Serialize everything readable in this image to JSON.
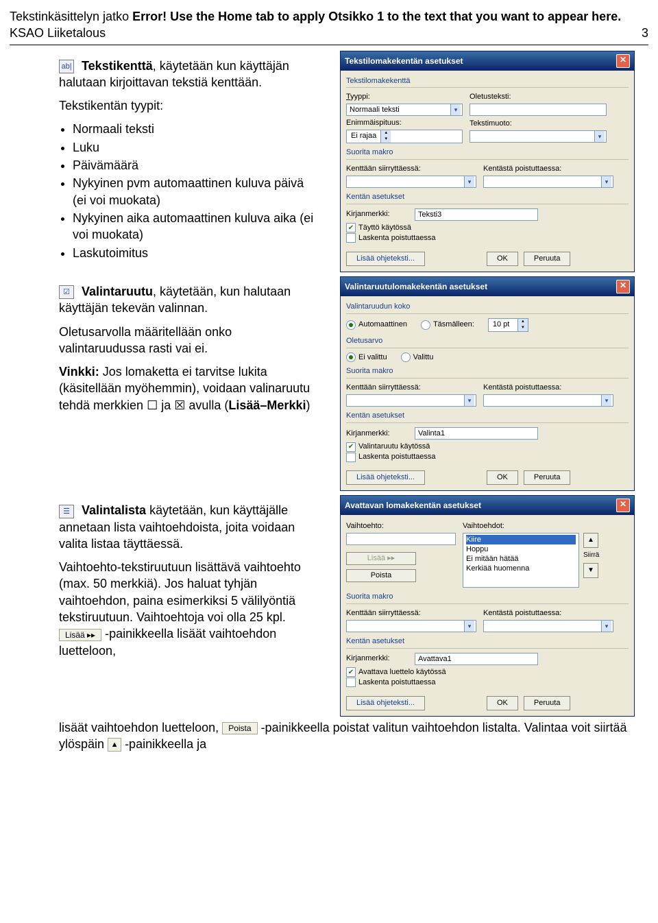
{
  "header": {
    "prefix": "Tekstinkäsittelyn jatko ",
    "error": "Error! Use the Home tab to apply Otsikko 1 to the text that you want to appear here.",
    "subtitle": "KSAO Liiketalous",
    "page_no": "3"
  },
  "section_textfield": {
    "icon_text": "ab|",
    "title_bold": "Tekstikenttä",
    "title_rest": ", käytetään kun käyttäjän halutaan kirjoittavan tekstiä kenttään.",
    "types_heading": "Tekstikentän tyypit:",
    "types": [
      "Normaali teksti",
      "Luku",
      "Päivämäärä",
      "Nykyinen pvm automaattinen kuluva päivä (ei voi muokata)",
      "Nykyinen aika automaattinen kuluva aika (ei voi muokata)",
      "Laskutoimitus"
    ]
  },
  "section_checkbox": {
    "title_bold": "Valintaruutu",
    "title_rest": ", käytetään, kun halutaan käyttäjän tekevän valinnan.",
    "para2": "Oletusarvolla määritellään onko valintaruudussa rasti vai ei.",
    "tip_prefix": "Vinkki:",
    "tip_body": " Jos lomaketta ei tarvitse lukita (käsitellään myöhemmin), voidaan valinaruutu tehdä merkkien ☐ ja ☒ avulla (",
    "tip_bold": "Lisää–Merkki",
    "tip_end": ")"
  },
  "section_dropdown": {
    "title_bold": "Valintalista",
    "title_rest": " käytetään, kun käyttäjälle annetaan lista vaihtoehdoista, joita voidaan valita listaa täyttäessä.",
    "para2_a": "Vaihtoehto-tekstiruutuun lisättävä vaihtoehto (max. 50 merkkiä). Jos haluat tyhjän vaihtoehdon, paina esimerkiksi 5 välilyöntiä tekstiruutuun. Vaihtoehtoja voi olla 25 kpl. ",
    "inline_btn_add": "Lisää ▸▸",
    "para2_b": "-painikkeella lisäät vaihtoehdon luetteloon, ",
    "inline_btn_del": "Poista",
    "para2_c": " -painikkeella poistat valitun vaihtoehdon listalta. Valintaa voit siirtää ylöspäin ",
    "inline_btn_up": "▲",
    "para2_d": " -painikkeella ja"
  },
  "dlg1": {
    "title": "Tekstilomakekentän asetukset",
    "grp1": "Tekstilomakekenttä",
    "type_label": "Tyyppi:",
    "type_value": "Normaali teksti",
    "default_label": "Oletusteksti:",
    "default_value": "",
    "maxlen_label": "Enimmäispituus:",
    "maxlen_value": "Ei rajaa",
    "format_label": "Tekstimuoto:",
    "format_value": "",
    "grp2": "Suorita makro",
    "macro_in_label": "Kenttään siirryttäessä:",
    "macro_out_label": "Kentästä poistuttaessa:",
    "grp3": "Kentän asetukset",
    "bookmark_label": "Kirjanmerkki:",
    "bookmark_value": "Teksti3",
    "cb_fill": "Täyttö käytössä",
    "cb_calc": "Laskenta poistuttaessa",
    "helptext": "Lisää ohjeteksti...",
    "ok": "OK",
    "cancel": "Peruuta"
  },
  "dlg2": {
    "title": "Valintaruutulomakekentän asetukset",
    "grp1": "Valintaruudun koko",
    "rb_auto": "Automaattinen",
    "rb_exact": "Täsmälleen:",
    "exact_value": "10 pt",
    "grp2": "Oletusarvo",
    "rb_unchecked": "Ei valittu",
    "rb_checked": "Valittu",
    "grp3": "Suorita makro",
    "macro_in_label": "Kenttään siirryttäessä:",
    "macro_out_label": "Kentästä poistuttaessa:",
    "grp4": "Kentän asetukset",
    "bookmark_label": "Kirjanmerkki:",
    "bookmark_value": "Valinta1",
    "cb_enabled": "Valintaruutu käytössä",
    "cb_calc": "Laskenta poistuttaessa",
    "helptext": "Lisää ohjeteksti...",
    "ok": "OK",
    "cancel": "Peruuta"
  },
  "dlg3": {
    "title": "Avattavan lomakekentän asetukset",
    "opt_label": "Vaihtoehto:",
    "opt_value": "",
    "list_label": "Vaihtoehdot:",
    "list_items": [
      "Kiire",
      "Hoppu",
      "Ei mitään hätää",
      "Kerkiää huomenna"
    ],
    "btn_add": "Lisää ▸▸",
    "btn_del": "Poista",
    "side_label": "Siirrä",
    "grp2": "Suorita makro",
    "macro_in_label": "Kenttään siirryttäessä:",
    "macro_out_label": "Kentästä poistuttaessa:",
    "grp3": "Kentän asetukset",
    "bookmark_label": "Kirjanmerkki:",
    "bookmark_value": "Avattava1",
    "cb_enabled": "Avattava luettelo käytössä",
    "cb_calc": "Laskenta poistuttaessa",
    "helptext": "Lisää ohjeteksti...",
    "ok": "OK",
    "cancel": "Peruuta"
  }
}
